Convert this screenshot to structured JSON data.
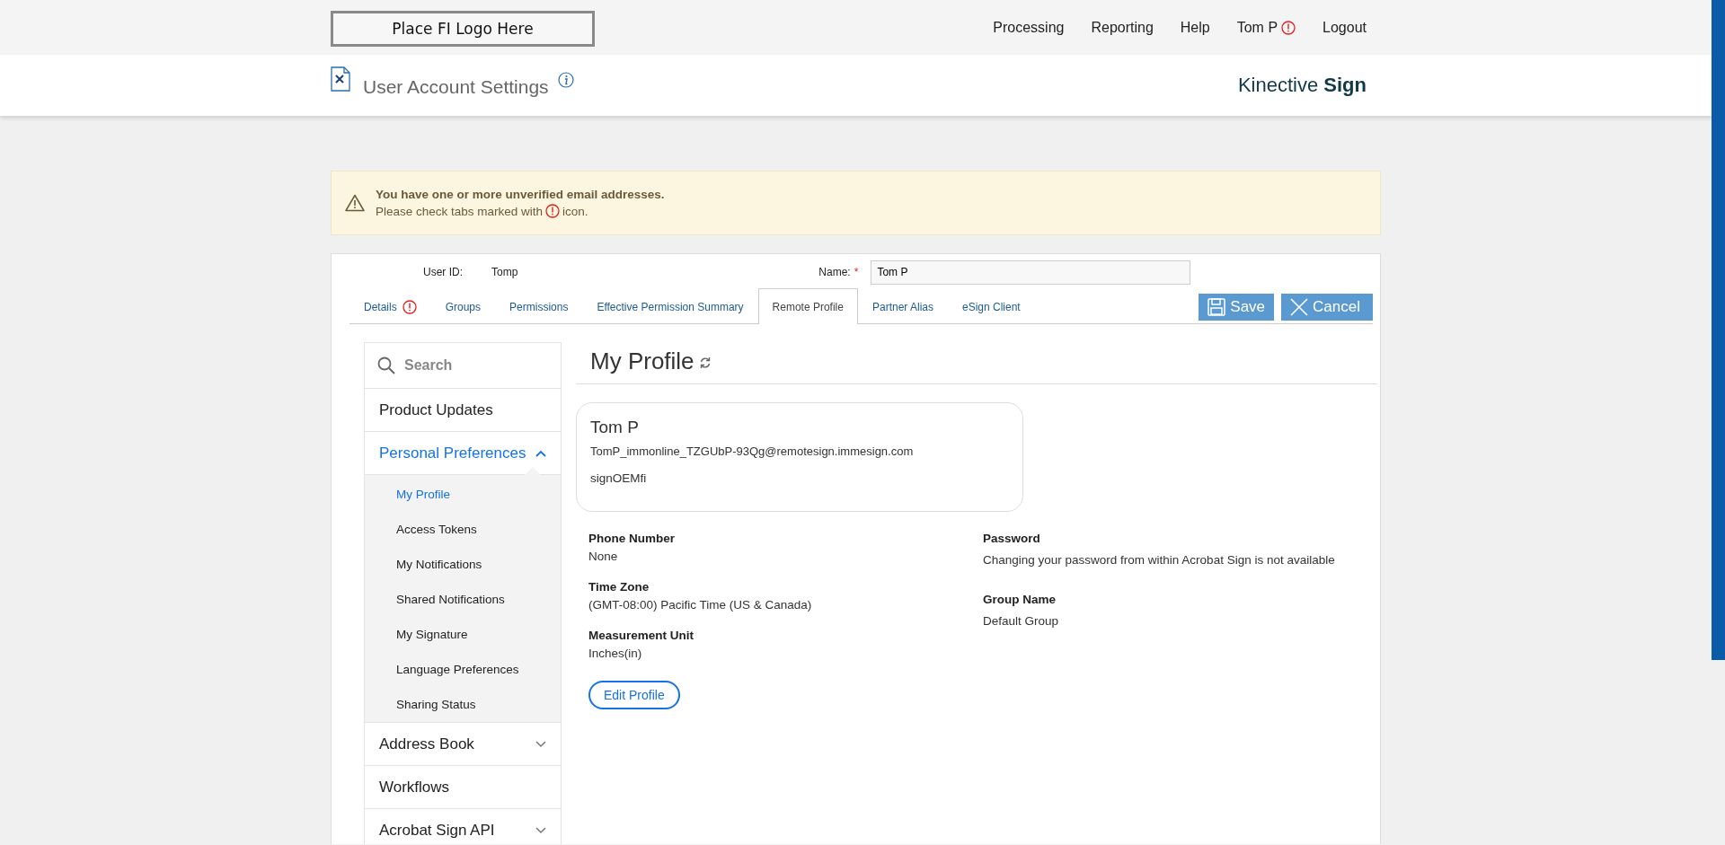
{
  "header": {
    "logo_placeholder": "Place FI Logo Here",
    "nav": [
      {
        "label": "Processing",
        "alert": false
      },
      {
        "label": "Reporting",
        "alert": false
      },
      {
        "label": "Help",
        "alert": false
      },
      {
        "label": "Tom P",
        "alert": true
      },
      {
        "label": "Logout",
        "alert": false
      }
    ],
    "page_title": "User Account Settings",
    "brand": "Kinective **Sign**"
  },
  "alert": {
    "title": "You have one or more unverified email addresses.",
    "message_before": "Please check tabs marked with",
    "message_after": "icon."
  },
  "user": {
    "user_id_label": "User ID:",
    "user_id": "Tomp",
    "name_label": "Name:",
    "required_mark": "*",
    "name_value": "Tom P"
  },
  "tabs": [
    {
      "label": "Details",
      "selected": false,
      "alert": true
    },
    {
      "label": "Groups",
      "selected": false,
      "alert": false
    },
    {
      "label": "Permissions",
      "selected": false,
      "alert": false
    },
    {
      "label": "Effective Permission Summary",
      "selected": false,
      "alert": false
    },
    {
      "label": "Remote Profile",
      "selected": true,
      "alert": false
    },
    {
      "label": "Partner Alias",
      "selected": false,
      "alert": false
    },
    {
      "label": "eSign Client",
      "selected": false,
      "alert": false
    }
  ],
  "buttons": {
    "save": "Save",
    "cancel": "Cancel"
  },
  "sidebar": {
    "search_placeholder": "Search",
    "items": [
      {
        "label": "Product Updates",
        "selected": false
      },
      {
        "label": "Personal Preferences",
        "selected": true,
        "expanded": true,
        "children": [
          {
            "label": "My Profile",
            "selected": true
          },
          {
            "label": "Access Tokens",
            "selected": false
          },
          {
            "label": "My Notifications",
            "selected": false
          },
          {
            "label": "Shared Notifications",
            "selected": false
          },
          {
            "label": "My Signature",
            "selected": false
          },
          {
            "label": "Language Preferences",
            "selected": false
          },
          {
            "label": "Sharing Status",
            "selected": false
          }
        ]
      },
      {
        "label": "Address Book",
        "selected": false,
        "expanded": false
      },
      {
        "label": "Workflows",
        "selected": false
      },
      {
        "label": "Acrobat Sign API",
        "selected": false,
        "expanded": false
      }
    ]
  },
  "profile": {
    "heading": "My Profile",
    "card": {
      "name": "Tom P",
      "email": "TomP_immonline_TZGUbP-93Qg@remotesign.immesign.com",
      "account": "signOEMfi"
    },
    "left_fields": [
      {
        "label": "Phone Number",
        "value": "None"
      },
      {
        "label": "Time Zone",
        "value": "(GMT-08:00) Pacific Time (US & Canada)"
      },
      {
        "label": "Measurement Unit",
        "value": "Inches(in)"
      }
    ],
    "right_fields": [
      {
        "label": "Password",
        "value": "Changing your password from within Acrobat Sign is not available"
      },
      {
        "label": "Group Name",
        "value": "Default Group"
      }
    ],
    "edit_button": "Edit Profile"
  }
}
